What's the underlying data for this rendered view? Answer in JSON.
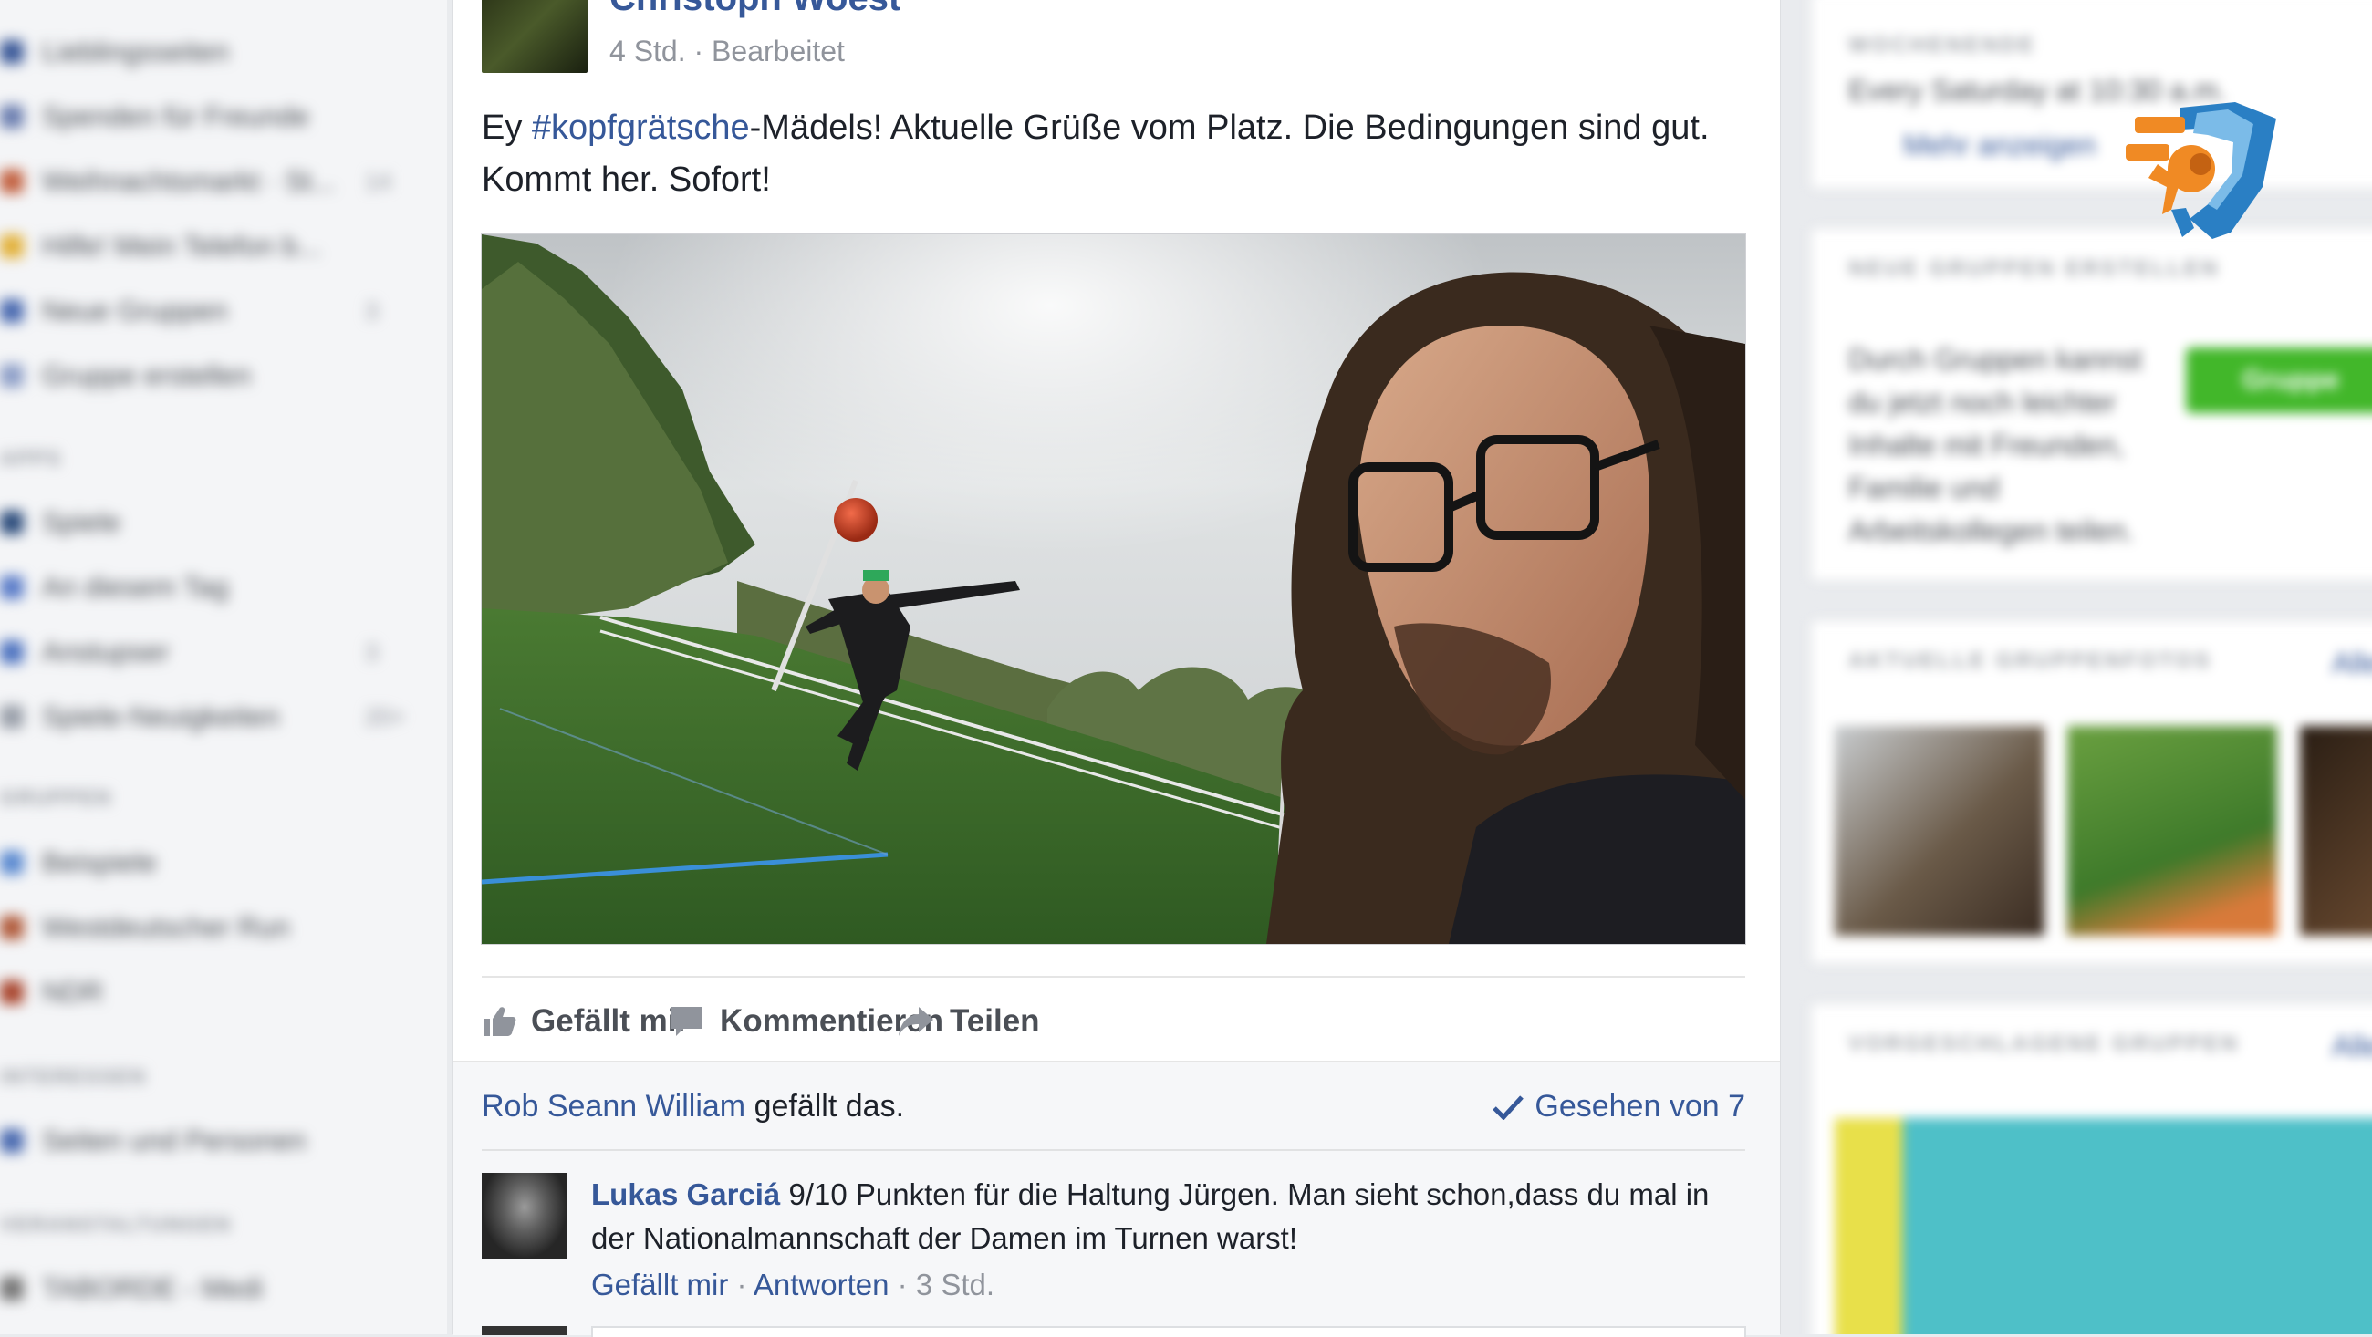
{
  "sidebar": {
    "items": [
      {
        "label": "Lieblingsseiten",
        "color": "#3b5998",
        "count": ""
      },
      {
        "label": "Spenden für Freunde",
        "color": "#6c7fb0",
        "count": ""
      },
      {
        "label": "Weihnachtsmarkt · St...",
        "color": "#c2603f",
        "count": "14"
      },
      {
        "label": "Hilfe! Mein Telefon b...",
        "color": "#e2b13a",
        "count": ""
      },
      {
        "label": "Neue Gruppen",
        "color": "#4a6ab0",
        "count": "3"
      },
      {
        "label": "Gruppe erstellen",
        "color": "#8fa0c8",
        "count": ""
      },
      {
        "label": "Spiele",
        "color": "#2a4a7a",
        "count": ""
      },
      {
        "label": "An diesem Tag",
        "color": "#5a7cc8",
        "count": ""
      },
      {
        "label": "Anstupser",
        "color": "#4f74c0",
        "count": "3"
      },
      {
        "label": "Spiele-Neuigkeiten",
        "color": "#9aa0aa",
        "count": "20+"
      },
      {
        "label": "Beispiele",
        "color": "#5b8ad0",
        "count": ""
      },
      {
        "label": "Westdeutscher Run",
        "color": "#b05a3a",
        "count": ""
      },
      {
        "label": "NDR",
        "color": "#a8442c",
        "count": ""
      },
      {
        "label": "Seiten und Personen",
        "color": "#4a6ab0",
        "count": ""
      },
      {
        "label": "TABORDE - Medi",
        "color": "#777",
        "count": ""
      }
    ],
    "headings": [
      "APPS",
      "GRUPPEN",
      "INTERESSEN",
      "VERANSTALTUNGEN"
    ]
  },
  "post": {
    "author": "Christoph Woest",
    "meta": "4 Std. · Bearbeitet",
    "text_before": "Ey ",
    "hashtag": "#kopfgrätsche",
    "text_after": "-Mädels! Aktuelle Grüße vom Platz. Die Bedingungen sind gut. Kommt her. Sofort!",
    "actions": {
      "like": "Gefällt mir",
      "comment": "Kommentieren",
      "share": "Teilen"
    }
  },
  "reactions": {
    "liker": "Rob Seann William",
    "likes_suffix": " gefällt das.",
    "seen": "Gesehen von 7"
  },
  "comment": {
    "author": "Lukas Garciá",
    "text": " 9/10 Punkten für die Haltung Jürgen. Man sieht schon,dass du mal in der Nationalmannschaft der Damen im Turnen warst!",
    "like": "Gefällt mir",
    "separator": " · ",
    "reply": "Antworten",
    "time": "3 Std."
  },
  "right_sidebar": {
    "event_head": "WOCHENENDE",
    "event_text": "Every Saturday at 10:30 a.m.",
    "more": "Mehr anzeigen",
    "create_group_head": "NEUE GRUPPEN ERSTELLEN",
    "create_group_text": [
      "Durch Gruppen kannst",
      "du jetzt noch leichter",
      "Inhalte mit Freunden,",
      "Familie und",
      "Arbeitskollegen teilen."
    ],
    "create_group_button": "Gruppe",
    "photos_head": "AKTUELLE GRUPPENFOTOS",
    "suggested_head": "VORGESCHLAGENE GRUPPEN",
    "see_all": "Alle"
  },
  "colors": {
    "link": "#365899",
    "meta": "#90949c",
    "brand_orange": "#f08a24",
    "brand_blue": "#2a7fc4"
  }
}
